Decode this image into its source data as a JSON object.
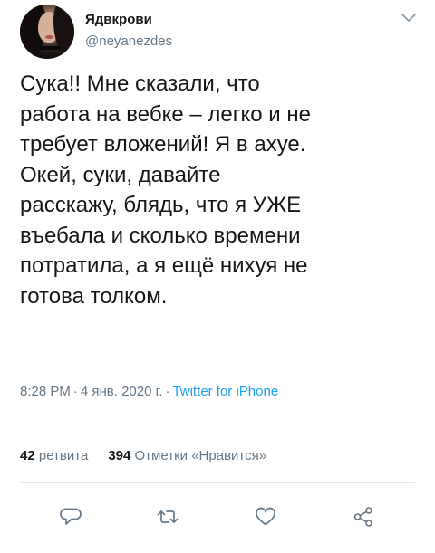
{
  "author": {
    "display_name": "Ядвкрови",
    "handle": "@neyanezdes",
    "avatar_icon": "avatar-photo"
  },
  "tweet": {
    "text": "Сука!! Мне сказали, что\nработа на вебке – легко и не\nтребует вложений! Я в ахуе.\nОкей, суки, давайте\nрасскажу, блядь, что я УЖЕ\nвъебала и сколько времени\nпотратила, а я ещё нихуя не\nготова толком."
  },
  "meta": {
    "time": "8:28 PM",
    "separator": "·",
    "date": "4 янв. 2020 г.",
    "source": "Twitter for iPhone"
  },
  "stats": {
    "retweets_count": "42",
    "retweets_label": "ретвита",
    "likes_count": "394",
    "likes_label": "Отметки «Нравится»"
  },
  "actions": [
    "reply-icon",
    "retweet-icon",
    "like-icon",
    "share-icon"
  ],
  "colors": {
    "text": "#14171a",
    "secondary": "#657786",
    "link": "#1da1f2",
    "divider": "#e1e8ed"
  }
}
